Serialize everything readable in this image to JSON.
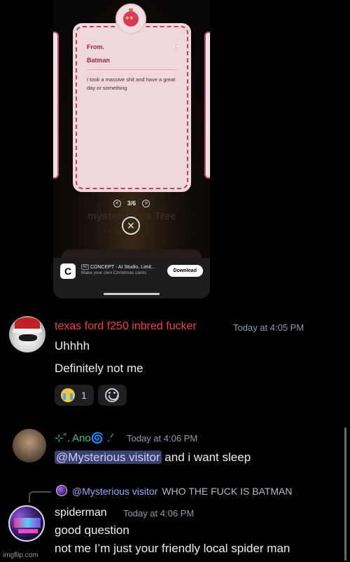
{
  "phone": {
    "card": {
      "from_label": "From.",
      "from_name": "Batman",
      "message": "I took a massive shit and have a great day or something"
    },
    "pager": {
      "text": "3/6",
      "prev_icon": "chevron-left-circle",
      "next_icon": "chevron-right-circle"
    },
    "tree_title": "mysterious's Tree",
    "ad": {
      "logo": "C",
      "tag": "AD",
      "title": "CONCEPT - AI Studio, Limit...",
      "subtitle": "Make your own Christmas cards",
      "button": "Download"
    }
  },
  "messages": [
    {
      "username": "texas ford f250 inbred fucker",
      "username_color": "#f23f42",
      "timestamp": "Today at 4:05 PM",
      "lines": [
        "Uhhhh",
        "Definitely not me"
      ],
      "reactions": [
        {
          "emoji": "loudly-crying-face",
          "count": "1"
        }
      ]
    },
    {
      "username": "⊹˚. Ano🌀 .ᐟ",
      "username_color": "#3ec29c",
      "timestamp": "Today at 4:06 PM",
      "mention": "@Mysterious visitor",
      "text": " and i want sleep"
    },
    {
      "reply": {
        "mention": "@Mysterious visitor",
        "text": "WHO THE FUCK IS BATMAN"
      },
      "username": "spiderman",
      "timestamp": "Today at 4:06 PM",
      "lines": [
        "good question",
        "not me I’m just your friendly local spider man"
      ]
    }
  ],
  "watermark": "imgflip.com"
}
